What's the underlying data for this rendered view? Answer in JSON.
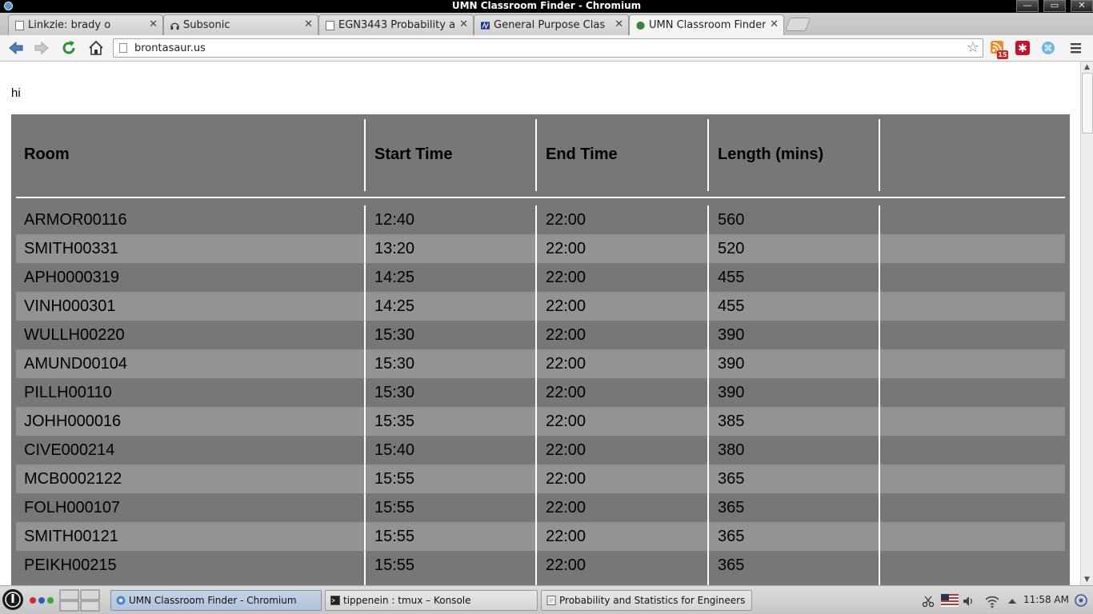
{
  "window": {
    "title": "UMN Classroom Finder - Chromium"
  },
  "tabs": [
    {
      "label": "Linkzie: brady o",
      "active": false
    },
    {
      "label": "Subsonic",
      "active": false
    },
    {
      "label": "EGN3443 Probability a",
      "active": false
    },
    {
      "label": "General Purpose Clas",
      "active": false
    },
    {
      "label": "UMN Classroom Finder",
      "active": true
    }
  ],
  "toolbar": {
    "url": "brontasaur.us",
    "rss_badge": "15"
  },
  "page": {
    "greeting": "hi",
    "table": {
      "headers": [
        "Room",
        "Start Time",
        "End Time",
        "Length (mins)"
      ],
      "rows": [
        [
          "ARMOR00116",
          "12:40",
          "22:00",
          "560"
        ],
        [
          "SMITH00331",
          "13:20",
          "22:00",
          "520"
        ],
        [
          "APH0000319",
          "14:25",
          "22:00",
          "455"
        ],
        [
          "VINH000301",
          "14:25",
          "22:00",
          "455"
        ],
        [
          "WULLH00220",
          "15:30",
          "22:00",
          "390"
        ],
        [
          "AMUND00104",
          "15:30",
          "22:00",
          "390"
        ],
        [
          "PILLH00110",
          "15:30",
          "22:00",
          "390"
        ],
        [
          "JOHH000016",
          "15:35",
          "22:00",
          "385"
        ],
        [
          "CIVE000214",
          "15:40",
          "22:00",
          "380"
        ],
        [
          "MCB0002122",
          "15:55",
          "22:00",
          "365"
        ],
        [
          "FOLH000107",
          "15:55",
          "22:00",
          "365"
        ],
        [
          "SMITH00121",
          "15:55",
          "22:00",
          "365"
        ],
        [
          "PEIKH00215",
          "15:55",
          "22:00",
          "365"
        ]
      ]
    }
  },
  "taskbar": {
    "tasks": [
      {
        "label": "UMN Classroom Finder - Chromium",
        "active": true
      },
      {
        "label": "tippenein : tmux – Konsole",
        "active": false
      },
      {
        "label": "Probability and Statistics for Engineers an",
        "active": false
      }
    ],
    "clock": "11:58 AM"
  },
  "colors": {
    "table_bg": "#777777",
    "row_alt": "#939393",
    "separator": "#ffffff"
  }
}
